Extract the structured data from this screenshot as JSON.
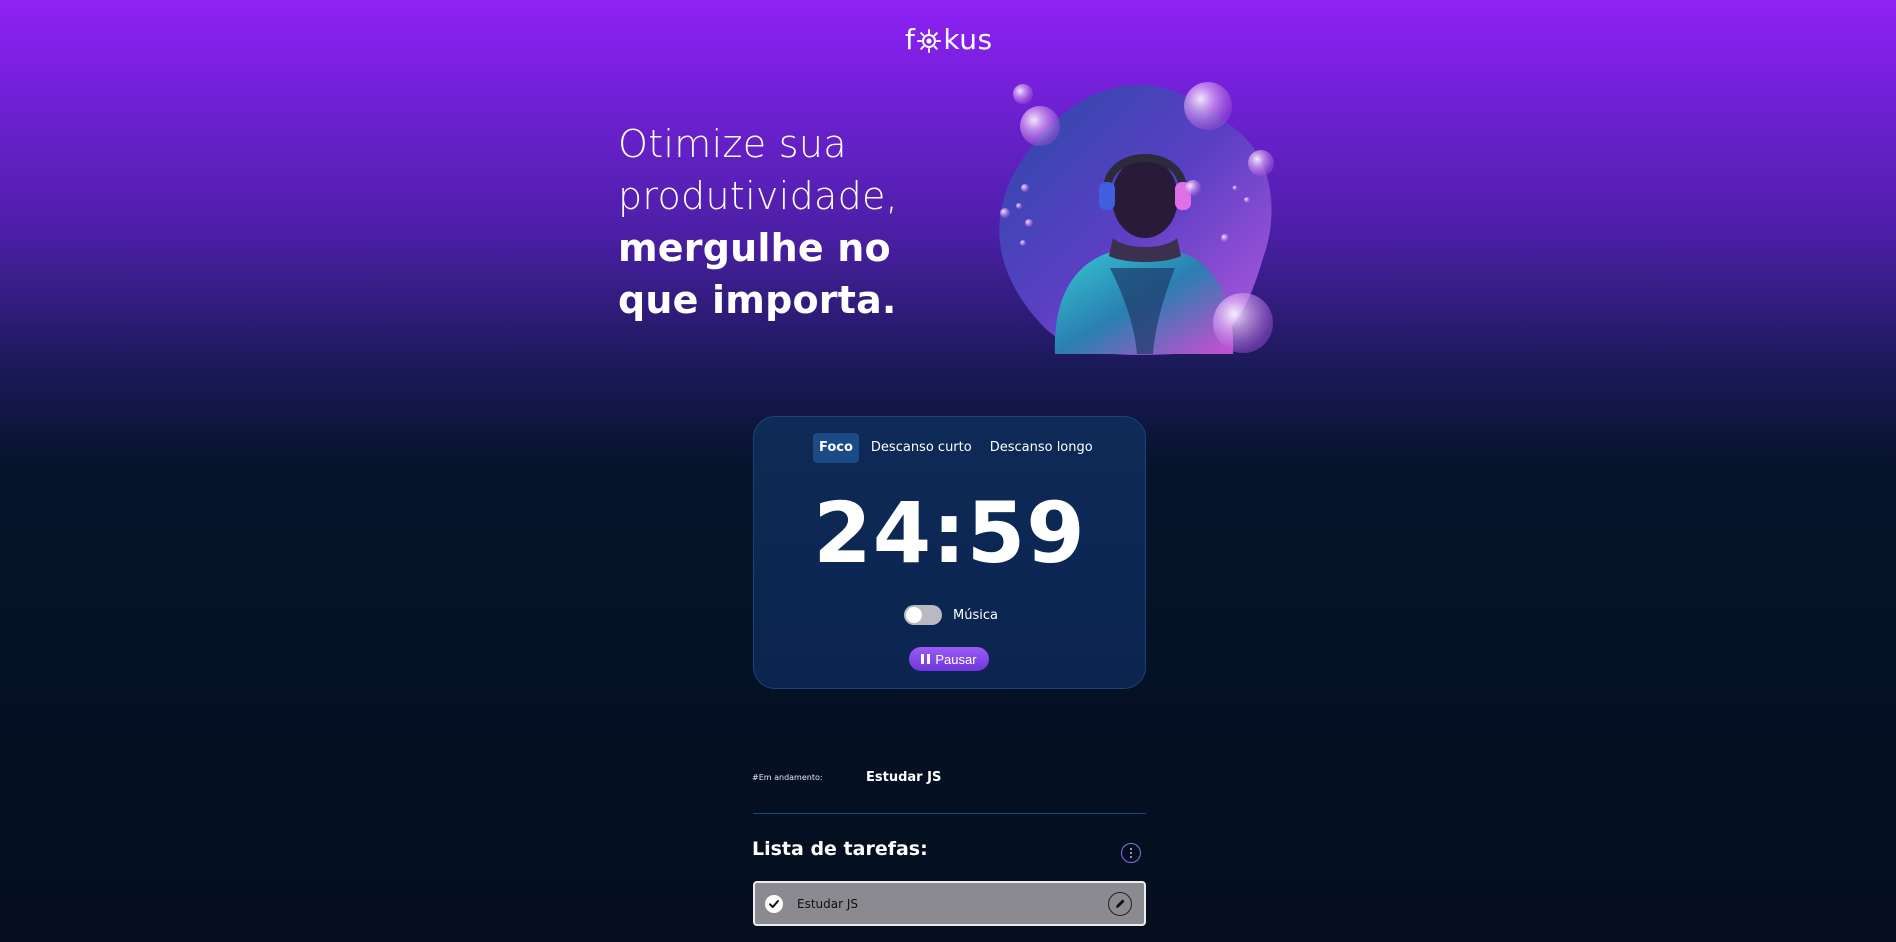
{
  "brand": {
    "logo_prefix": "f",
    "logo_suffix": "kus"
  },
  "hero": {
    "line1": "Otimize sua",
    "line2": "produtividade,",
    "line3": "mergulhe no",
    "line4": "que importa."
  },
  "timer": {
    "tabs": [
      {
        "label": "Foco",
        "active": true
      },
      {
        "label": "Descanso curto",
        "active": false
      },
      {
        "label": "Descanso longo",
        "active": false
      }
    ],
    "time": "24:59",
    "music_label": "Música",
    "music_on": false,
    "pause_label": "Pausar"
  },
  "in_progress": {
    "label": "#Em andamento:",
    "task": "Estudar JS"
  },
  "task_list": {
    "title": "Lista de tarefas:",
    "items": [
      {
        "name": "Estudar JS",
        "completed": true
      }
    ]
  },
  "colors": {
    "accent": "#9021f5",
    "card_bg": "#0b2450",
    "active_tab": "#1b4b86",
    "button": "#7c42e8"
  }
}
